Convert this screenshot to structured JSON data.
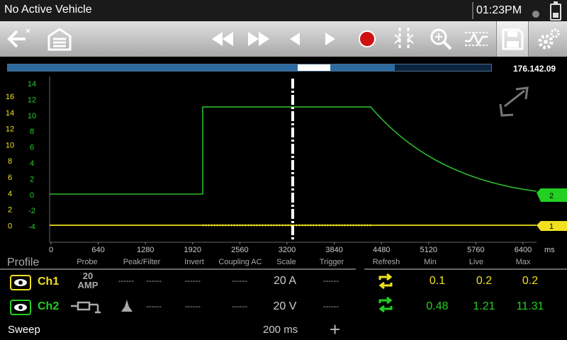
{
  "status": {
    "title": "No Active Vehicle",
    "time": "01:23PM"
  },
  "toolbar": {
    "buttons": [
      {
        "name": "back-icon",
        "icon": "back-arrow"
      },
      {
        "name": "garage-icon",
        "icon": "garage"
      },
      {
        "name": "rewind-icon",
        "icon": "double-left"
      },
      {
        "name": "fast-forward-icon",
        "icon": "double-right"
      },
      {
        "name": "step-back-icon",
        "icon": "triangle-left"
      },
      {
        "name": "play-icon",
        "icon": "triangle-right"
      },
      {
        "name": "record-icon",
        "icon": "red-dot"
      },
      {
        "name": "cursor-icon",
        "icon": "cursors"
      },
      {
        "name": "zoom-icon",
        "icon": "magnifier"
      },
      {
        "name": "trigger-icon",
        "icon": "waveform"
      },
      {
        "name": "save-icon",
        "icon": "floppy"
      },
      {
        "name": "settings-icon",
        "icon": "gears"
      }
    ]
  },
  "playback": {
    "position_label": "176.142.09",
    "buffer_fraction": 0.8,
    "cursor_fraction": 0.6
  },
  "plot": {
    "left_axis_ticks": [
      "16",
      "14",
      "12",
      "10",
      "8",
      "6",
      "4",
      "2",
      "0"
    ],
    "right_axis_ticks": [
      "14",
      "12",
      "10",
      "8",
      "6",
      "4",
      "2",
      "0",
      "-2",
      "-4"
    ],
    "x_ticks": [
      "0",
      "640",
      "1280",
      "1920",
      "2560",
      "3200",
      "3840",
      "4480",
      "5120",
      "5760",
      "6400"
    ],
    "x_unit": "ms",
    "channel_markers": [
      "2",
      "1"
    ]
  },
  "profile": {
    "title": "Profile",
    "headers": [
      "Probe",
      "Peak/Filter",
      "Invert",
      "Coupling AC",
      "Scale",
      "Trigger",
      "Refresh",
      "Min",
      "Live",
      "Max"
    ]
  },
  "channels": [
    {
      "label": "Ch1",
      "color": "#f0e020",
      "probe": "20 AMP",
      "probe_top": "20",
      "probe_bottom": "AMP",
      "peak": "------",
      "filter": "------",
      "invert": "------",
      "coupling": "------",
      "scale": "20 A",
      "trigger": "------",
      "min": "0.1",
      "live": "0.2",
      "max": "0.2"
    },
    {
      "label": "Ch2",
      "color": "#22d022",
      "probe": "test-lead",
      "peak": "------",
      "filter": "------",
      "invert": "------",
      "coupling": "------",
      "scale": "20 V",
      "trigger": "------",
      "min": "0.48",
      "live": "1.21",
      "max": "11.31"
    }
  ],
  "sweep": {
    "label": "Sweep",
    "value": "200 ms"
  },
  "colors": {
    "accent_yellow": "#f0e020",
    "accent_green": "#22d022",
    "trace_green": "#2db82d"
  }
}
